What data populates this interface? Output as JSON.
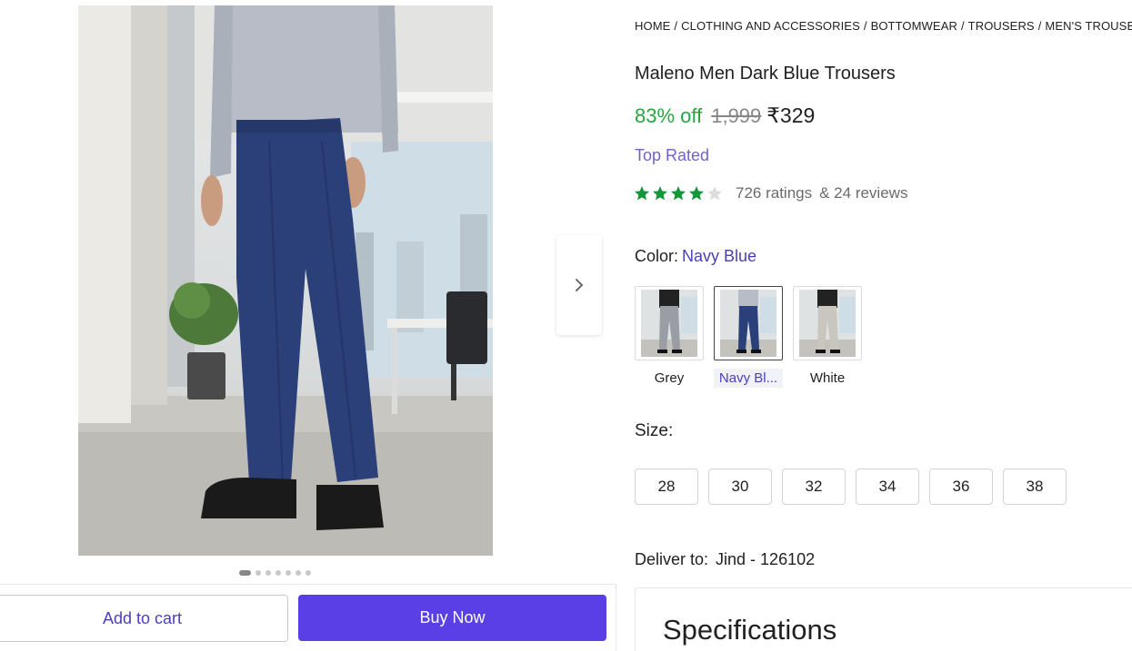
{
  "breadcrumb": [
    "HOME",
    "CLOTHING AND ACCESSORIES",
    "BOTTOMWEAR",
    "TROUSERS",
    "MEN'S TROUSERS"
  ],
  "product": {
    "title": "Maleno Men Dark Blue Trousers",
    "discount": "83% off",
    "mrp": "1,999",
    "price": "₹329",
    "badge": "Top Rated",
    "rating": 4,
    "rating_max": 5,
    "ratings_count": "726 ratings",
    "reviews_count": "& 24 reviews"
  },
  "gallery": {
    "image_count": 7,
    "active_index": 0
  },
  "color": {
    "label": "Color:",
    "selected": "Navy Blue",
    "options": [
      {
        "label": "Grey",
        "trouser_color": "#9a9ea4"
      },
      {
        "label": "Navy Bl...",
        "trouser_color": "#2b3f78"
      },
      {
        "label": "White",
        "trouser_color": "#c9c6bf"
      }
    ],
    "selected_index": 1
  },
  "size": {
    "label": "Size:",
    "options": [
      "28",
      "30",
      "32",
      "34",
      "36",
      "38"
    ]
  },
  "delivery": {
    "label": "Deliver to:",
    "location": "Jind - 126102"
  },
  "actions": {
    "add_to_cart": "Add to cart",
    "buy_now": "Buy Now"
  },
  "specifications": {
    "heading": "Specifications"
  },
  "colors": {
    "accent": "#5a3ee6",
    "link": "#4b3fb8",
    "discount": "#26a541",
    "star": "#14963b"
  }
}
